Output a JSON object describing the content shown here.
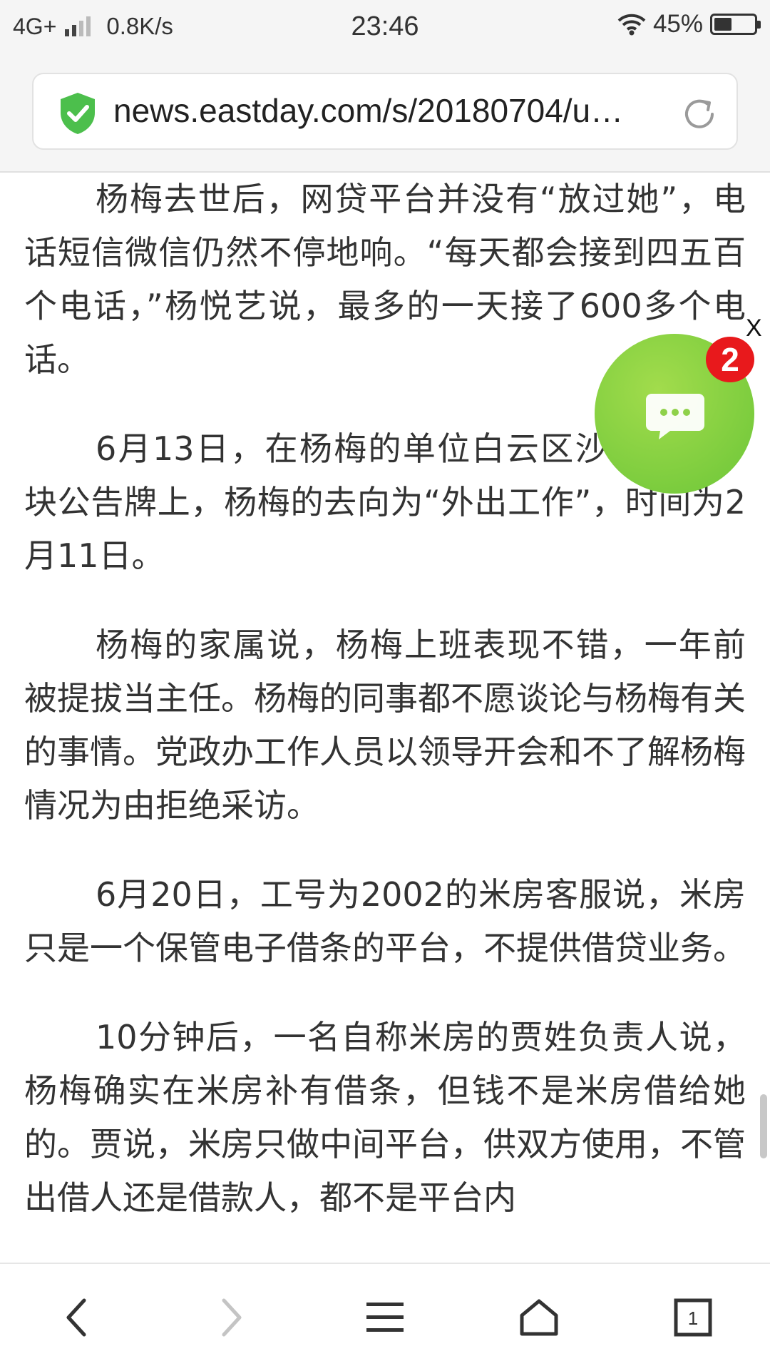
{
  "status_bar": {
    "network": "4G+",
    "speed": "0.8K/s",
    "time": "23:46",
    "battery_percent": "45%",
    "battery_level": 0.45,
    "signal_bars_filled": 2,
    "signal_bars_total": 4
  },
  "browser": {
    "url": "news.eastday.com/s/20180704/u…",
    "secure_icon": "shield-check-icon",
    "reload_icon": "reload-icon",
    "accent_green": "#4cbf4c"
  },
  "article": {
    "paragraphs": [
      "杨梅去世后，网贷平台并没有“放过她”，电话短信微信仍然不停地响。“每天都会接到四五百个电话，”杨悦艺说，最多的一天接了600多个电话。",
      "6月13日，在杨梅的单位白云区沙治办的一块公告牌上，杨梅的去向为“外出工作”，时间为2月11日。",
      "杨梅的家属说，杨梅上班表现不错，一年前被提拔当主任。杨梅的同事都不愿谈论与杨梅有关的事情。党政办工作人员以领导开会和不了解杨梅情况为由拒绝采访。",
      "6月20日，工号为2002的米房客服说，米房只是一个保管电子借条的平台，不提供借贷业务。",
      "10分钟后，一名自称米房的贾姓负责人说，杨梅确实在米房补有借条，但钱不是米房借给她的。贾说，米房只做中间平台，供双方使用，不管出借人还是借款人，都不是平台内"
    ]
  },
  "floating_chat": {
    "badge_count": "2",
    "close_label": "X",
    "icon": "chat-bubble-icon",
    "bubble_color": "#7acb3c",
    "badge_color": "#e8191c"
  },
  "bottom_nav": {
    "back_icon": "back-arrow-icon",
    "forward_icon": "forward-arrow-icon",
    "menu_icon": "menu-icon",
    "home_icon": "home-icon",
    "tabs_count": "1"
  }
}
